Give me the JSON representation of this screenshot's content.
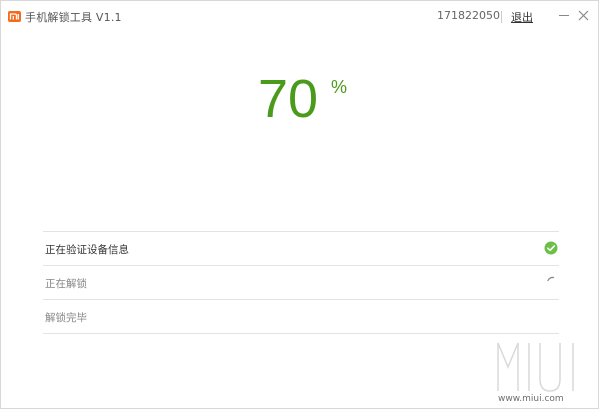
{
  "title_bar": {
    "app_title": "手机解锁工具  V1.1",
    "account_id": "171822050",
    "logout_label": "退出",
    "logo_icon": "mi-logo-icon",
    "minimize_icon": "minimize-icon",
    "close_icon": "close-icon"
  },
  "progress": {
    "value": "70",
    "unit": "%",
    "color": "#4a9a1c"
  },
  "steps": [
    {
      "label": "正在验证设备信息",
      "status": "done",
      "icon": "check-circle-icon"
    },
    {
      "label": "正在解锁",
      "status": "in-progress",
      "icon": "spinner-icon"
    },
    {
      "label": "解锁完毕",
      "status": "pending",
      "icon": ""
    }
  ],
  "watermark": {
    "brand": "MIUI",
    "site": "www.miui.com"
  },
  "colors": {
    "accent_orange": "#f56b1e",
    "success_green": "#6cc04a",
    "progress_green": "#4a9a1c"
  }
}
